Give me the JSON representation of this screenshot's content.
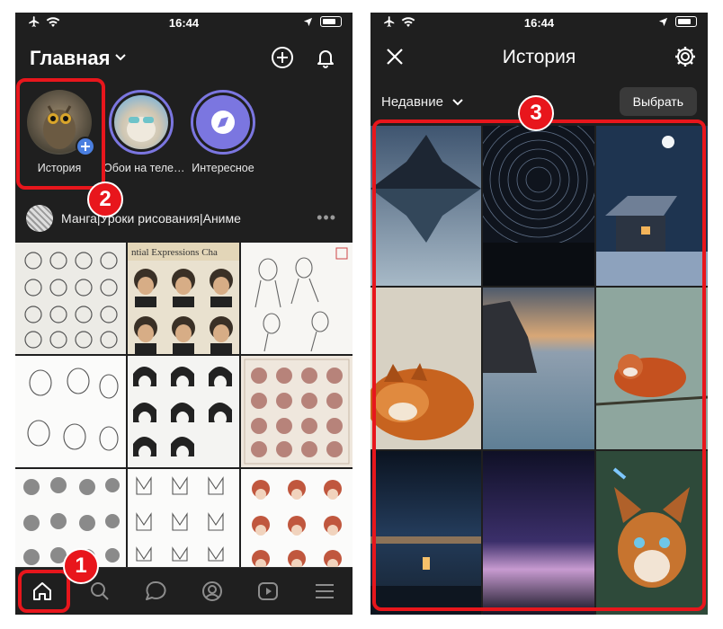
{
  "left_screen": {
    "status": {
      "time": "16:44"
    },
    "header": {
      "title": "Главная"
    },
    "stories": [
      {
        "label": "История"
      },
      {
        "label": "Обои на теле…"
      },
      {
        "label": "Интересное"
      }
    ],
    "post": {
      "author": "Манга|Уроки рисования|Аниме"
    }
  },
  "right_screen": {
    "status": {
      "time": "16:44"
    },
    "header": {
      "title": "История"
    },
    "filter": {
      "label": "Недавние"
    },
    "select_button": "Выбрать"
  },
  "annotations": {
    "badge1": "1",
    "badge2": "2",
    "badge3": "3"
  },
  "colors": {
    "background": "#1f1f1f",
    "highlight": "#e8161c",
    "story_ring": "#7b76e0",
    "add_badge": "#4a7fe0"
  }
}
